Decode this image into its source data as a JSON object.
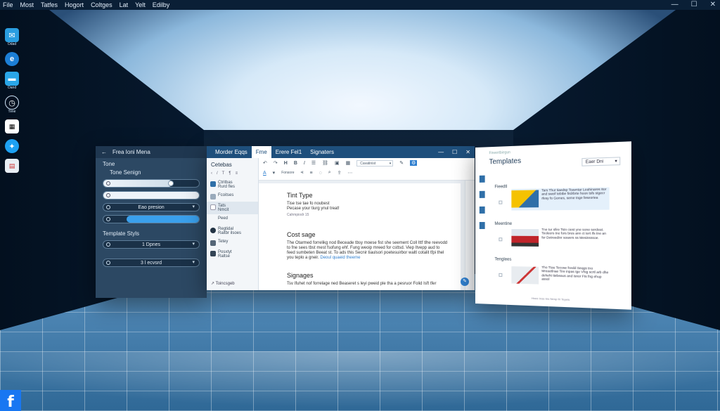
{
  "menubar": {
    "items": [
      "File",
      "Most",
      "Tatfes",
      "Hogort",
      "Coltges",
      "Lat",
      "Yelt",
      "Edilby"
    ]
  },
  "desktop": {
    "icons": [
      {
        "label": "Odad",
        "icon": "chat-app-icon"
      },
      {
        "label": "",
        "icon": "edge-browser-icon"
      },
      {
        "label": "Oand",
        "icon": "folder-icon"
      },
      {
        "label": "Time",
        "icon": "clock-icon"
      },
      {
        "label": "",
        "icon": "qr-code-icon"
      },
      {
        "label": "",
        "icon": "twitter-icon"
      },
      {
        "label": "",
        "icon": "document-icon"
      }
    ],
    "facebook": "f"
  },
  "panel_left": {
    "title": "Frea Ioni Mena",
    "tone": "Tone",
    "tone_sub": "Tone Senign",
    "rows": [
      "",
      "",
      "Eao presion",
      ""
    ],
    "template_styles": "Template Styls",
    "style_rows": [
      "1 Dpnes",
      "3 l ecvsrd"
    ]
  },
  "editor": {
    "tabs": [
      "Morder Eqqs",
      "Fme",
      "Erere Fel1",
      "Signaters"
    ],
    "sidebar": {
      "head": "Cetebas",
      "tools": [
        "‹",
        "/",
        "T",
        "¶",
        "≡"
      ],
      "items": [
        {
          "title": "Ctritbas",
          "sub": "Rurd fles"
        },
        {
          "title": "Fcoitses",
          "sub": ""
        },
        {
          "title": "Tats",
          "sub": "Nmcit"
        },
        {
          "title": "Peed",
          "sub": ""
        },
        {
          "title": "Regtidal",
          "sub": "Raitbr ilsoes"
        },
        {
          "title": "Tetey",
          "sub": ""
        },
        {
          "title": "Posxtyt",
          "sub": "Raltse"
        }
      ],
      "footer": "Toincsgeb"
    },
    "toolbar": {
      "font": "Cavatinist",
      "row2_label": "Fonsore"
    },
    "doc": {
      "h1": "Tint Type",
      "p1": "Tise tse tae fo noubest",
      "p1b": "Pecase your tiurg ynul treat!",
      "cap": "Cahmpiodr 15",
      "h2": "Cost sage",
      "p2": "The Otarmed forrelikg nod Beceade tbsy moese fist she seement Coll Ittf tlhe reevodd to fne sees tbst mest fsofung ehf. Fung weoip mreed for csttsd. Viep Itvepp aud to feed sumbeten Beeat st. To ads this Secnir tiaulsori poetesuirbor waltl cotalit tfpi thel you teplo a gneir.",
      "link": "Deoul quaeid theeme",
      "h3": "Signages",
      "p3": "Tsv Ifuhet nof forrelage ned Beaseret s leyi pweid ple tha a pesruor Folid Isft tfer"
    }
  },
  "panel_right": {
    "caption": "Fineertbiegun",
    "title": "Templates",
    "dropdown": "Eaer Dni",
    "sections": [
      "Fieedtl",
      "Meentine",
      "Tenglees"
    ],
    "cards": [
      "Tars Thur tiaedsp Toavntar Leahinares Itor and sweif tebtbe firdrbrte hoon tsfs stgecr rfesy fo Gomes, seme tnge feseoriea",
      "Tne tur sfire Tstn ciest yne sone serdeat. Teoleers tne fors bres ann ct tert ifs tne an for Detreedinr sowers ss Mesinsssoe.",
      "Tho Ttau Tecose fcedd Seqgs tno Mreaetlnae Tire inpas tge Vhig scrtl arb dhe deheht ttebeaus and isnor Fts fng ehup assol"
    ],
    "footer": "Hnee Inse bis Nenp fri Teyeis"
  },
  "colors": {
    "accent": "#1e4f7c",
    "accent_light": "#3aa0ec",
    "panel_dark": "#2c4863"
  }
}
